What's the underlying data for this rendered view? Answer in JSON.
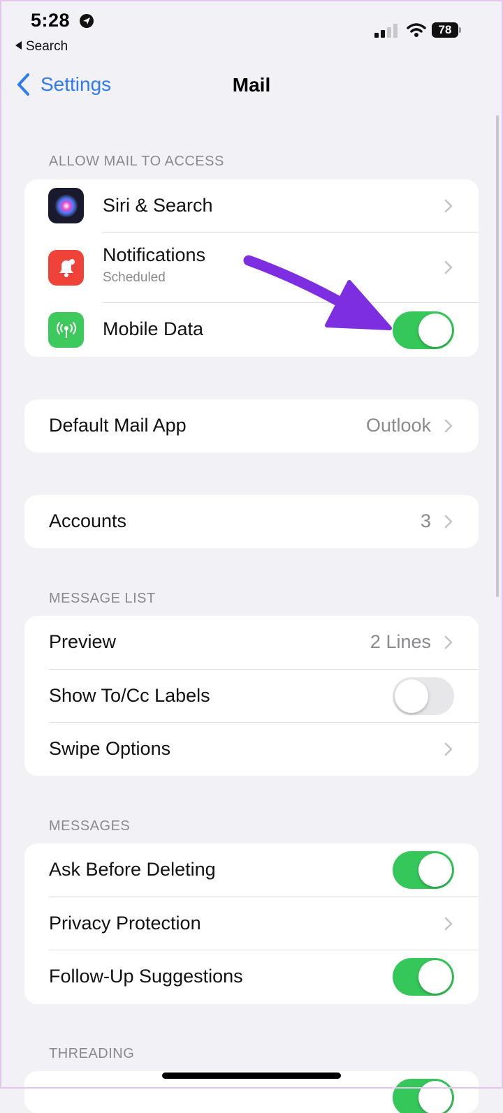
{
  "status_bar": {
    "time": "5:28",
    "back_app": "Search",
    "battery": "78"
  },
  "nav": {
    "back_label": "Settings",
    "title": "Mail"
  },
  "sections": {
    "allow_access": {
      "header": "ALLOW MAIL TO ACCESS",
      "rows": [
        {
          "label": "Siri & Search"
        },
        {
          "label": "Notifications",
          "subtitle": "Scheduled"
        },
        {
          "label": "Mobile Data",
          "toggle": true
        }
      ]
    },
    "default_app": {
      "label": "Default Mail App",
      "value": "Outlook"
    },
    "accounts": {
      "label": "Accounts",
      "value": "3"
    },
    "message_list": {
      "header": "MESSAGE LIST",
      "rows": [
        {
          "label": "Preview",
          "value": "2 Lines"
        },
        {
          "label": "Show To/Cc Labels",
          "toggle": false
        },
        {
          "label": "Swipe Options"
        }
      ]
    },
    "messages": {
      "header": "MESSAGES",
      "rows": [
        {
          "label": "Ask Before Deleting",
          "toggle": true
        },
        {
          "label": "Privacy Protection"
        },
        {
          "label": "Follow-Up Suggestions",
          "toggle": true
        }
      ]
    },
    "threading": {
      "header": "THREADING",
      "first_toggle": true
    }
  },
  "colors": {
    "accent": "#2f7bf6",
    "toggle_on": "#35c759",
    "annotation_arrow": "#7d2ee0",
    "siri_icon": "#1a1a2e",
    "notifications_icon": "#ef4238",
    "mobile_data_icon": "#3ec95c"
  },
  "icons": {
    "siri": "siri-icon",
    "notifications": "bell-icon",
    "mobile_data": "antenna-icon",
    "chevron": "chevron-right-icon"
  }
}
